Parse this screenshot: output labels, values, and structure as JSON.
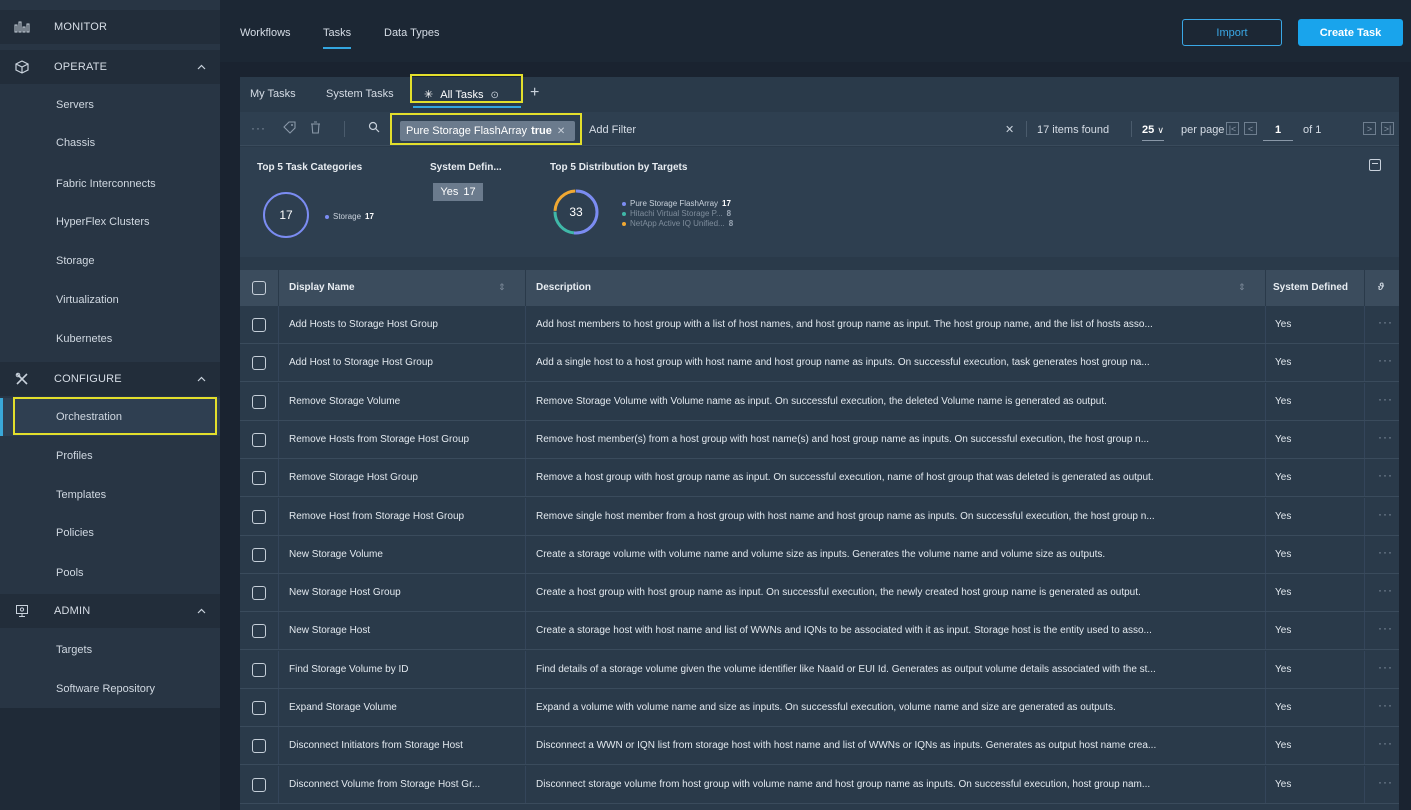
{
  "sidebar": {
    "sections": {
      "monitor": "MONITOR",
      "operate": "OPERATE",
      "configure": "CONFIGURE",
      "admin": "ADMIN"
    },
    "operate_items": [
      "Servers",
      "Chassis",
      "Fabric Interconnects",
      "HyperFlex Clusters",
      "Storage",
      "Virtualization",
      "Kubernetes"
    ],
    "configure_items": [
      "Orchestration",
      "Profiles",
      "Templates",
      "Policies",
      "Pools"
    ],
    "admin_items": [
      "Targets",
      "Software Repository"
    ],
    "active_item": "Orchestration"
  },
  "topbar": {
    "tabs": [
      "Workflows",
      "Tasks",
      "Data Types"
    ],
    "active_tab": "Tasks",
    "import_label": "Import",
    "create_label": "Create Task"
  },
  "panel_tabs": {
    "tabs": [
      "My Tasks",
      "System Tasks",
      "All Tasks"
    ],
    "active": "All Tasks",
    "add": "+"
  },
  "filter": {
    "chip_label": "Pure Storage FlashArray",
    "chip_value": "true",
    "add_filter": "Add Filter",
    "items_found": "17 items found",
    "per_page_value": "25",
    "per_page_label": "per page",
    "page_current": "1",
    "page_of": "of 1"
  },
  "summary": {
    "categories": {
      "title": "Top 5 Task Categories",
      "total": "17",
      "legend": [
        {
          "name": "Storage",
          "value": "17",
          "color": "#7b8cf2"
        }
      ]
    },
    "system_defined": {
      "title": "System Defin...",
      "badge_label": "Yes",
      "badge_value": "17"
    },
    "targets": {
      "title": "Top 5 Distribution by Targets",
      "total": "33",
      "legend": [
        {
          "name": "Pure Storage FlashArray",
          "value": "17",
          "color": "#7b8cf2"
        },
        {
          "name": "Hitachi Virtual Storage P...",
          "value": "8",
          "color": "#3fb8a8"
        },
        {
          "name": "NetApp Active IQ Unified...",
          "value": "8",
          "color": "#f0a832"
        }
      ]
    }
  },
  "table": {
    "headers": {
      "name": "Display Name",
      "description": "Description",
      "system": "System Defined"
    },
    "rows": [
      {
        "name": "Add Hosts to Storage Host Group",
        "desc": "Add host members to host group with a list of host names, and host group name as input. The host group name, and the list of hosts asso...",
        "sys": "Yes"
      },
      {
        "name": "Add Host to Storage Host Group",
        "desc": "Add a single host to a host group with host name and host group name as inputs. On successful execution, task generates host group na...",
        "sys": "Yes"
      },
      {
        "name": "Remove Storage Volume",
        "desc": "Remove Storage Volume with Volume name as input. On successful execution, the deleted Volume name is generated as output.",
        "sys": "Yes"
      },
      {
        "name": "Remove Hosts from Storage Host Group",
        "desc": "Remove host member(s) from a host group with host name(s) and host group name as inputs. On successful execution, the host group n...",
        "sys": "Yes"
      },
      {
        "name": "Remove Storage Host Group",
        "desc": "Remove a host group with host group name as input. On successful execution, name of host group that was deleted is generated as output.",
        "sys": "Yes"
      },
      {
        "name": "Remove Host from Storage Host Group",
        "desc": "Remove single host member from a host group with host name and host group name as inputs. On successful execution, the host group n...",
        "sys": "Yes"
      },
      {
        "name": "New Storage Volume",
        "desc": "Create a storage volume with volume name and volume size as inputs. Generates the volume name and volume size as outputs.",
        "sys": "Yes"
      },
      {
        "name": "New Storage Host Group",
        "desc": "Create a host group with host group name as input. On successful execution, the newly created host group name is generated as output.",
        "sys": "Yes"
      },
      {
        "name": "New Storage Host",
        "desc": "Create a storage host with host name and list of WWNs and IQNs to be associated with it as input. Storage host is the entity used to asso...",
        "sys": "Yes"
      },
      {
        "name": "Find Storage Volume by ID",
        "desc": "Find details of a storage volume given the volume identifier like NaaId or EUI Id. Generates as output volume details associated with the st...",
        "sys": "Yes"
      },
      {
        "name": "Expand Storage Volume",
        "desc": "Expand a volume with volume name and size as inputs. On successful execution, volume name and size are generated as outputs.",
        "sys": "Yes"
      },
      {
        "name": "Disconnect Initiators from Storage Host",
        "desc": "Disconnect a WWN or IQN list from storage host with host name and list of WWNs or IQNs as inputs. Generates as output host name crea...",
        "sys": "Yes"
      },
      {
        "name": "Disconnect Volume from Storage Host Gr...",
        "desc": "Disconnect storage volume from host group with volume name and host group name as inputs. On successful execution, host group nam...",
        "sys": "Yes"
      }
    ]
  }
}
